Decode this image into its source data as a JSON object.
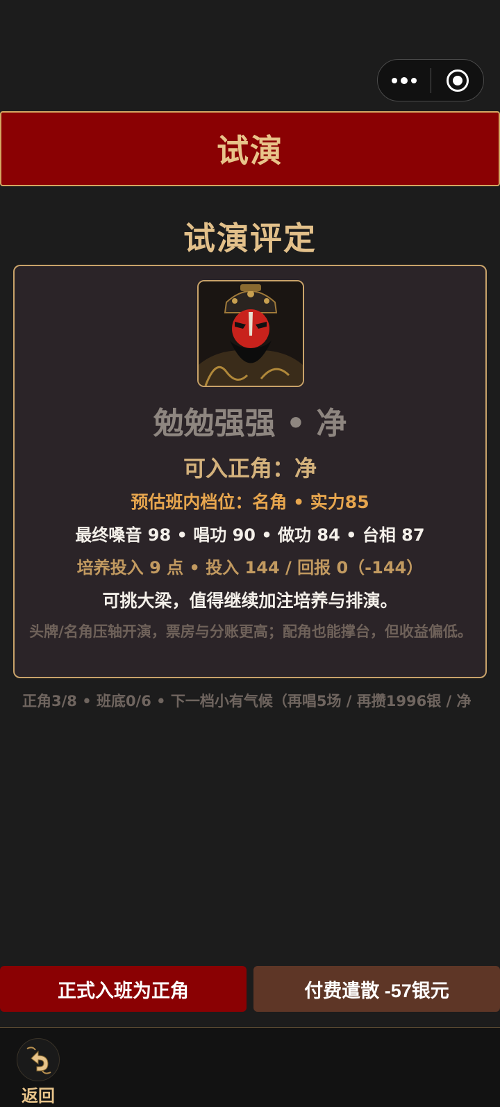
{
  "capsule": {
    "more_icon": "more-dots-icon",
    "close_icon": "target-close-icon"
  },
  "header": {
    "title": "试演"
  },
  "section": {
    "title": "试演评定"
  },
  "card": {
    "portrait_icon": "opera-jing-portrait",
    "name": "勉勉强强 • 净",
    "role": "可入正角：净",
    "rank": "预估班内档位：名角 • 实力85",
    "stats": "最终嗓音 98 • 唱功 90 • 做功 84 • 台相 87",
    "investment": "培养投入 9 点 • 投入 144 / 回报 0（-144）",
    "verdict": "可挑大梁，值得继续加注培养与排演。",
    "description": "头牌/名角压轴开演，票房与分账更高；配角也能撑台，但收益偏低。"
  },
  "status": {
    "text": "正角3/8 • 班底0/6 • 下一档小有气候（再唱5场 / 再攒1996银 / 净"
  },
  "actions": {
    "join_label": "正式入班为正角",
    "dismiss_label": "付费遣散 -57银元"
  },
  "bottom": {
    "back_icon": "back-arrow-icon",
    "back_label": "返回"
  },
  "colors": {
    "header_red": "#8a0103",
    "gold": "#d4a862",
    "dismiss_brown": "#5e3626"
  }
}
